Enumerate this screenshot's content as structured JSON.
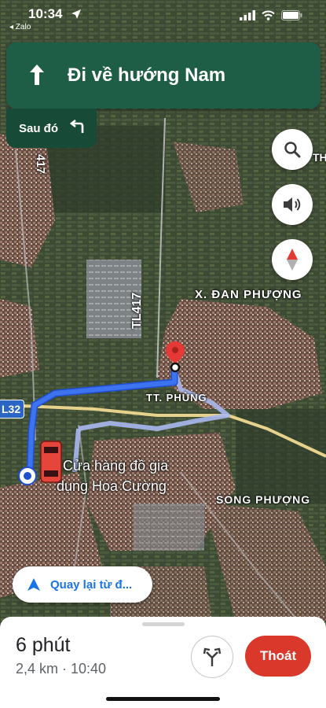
{
  "status_bar": {
    "time": "10:34",
    "back_app": "◂ Zalo"
  },
  "navigation": {
    "instruction": "Đi về hướng Nam",
    "then_label": "Sau đó"
  },
  "map": {
    "labels": {
      "district": "X. ĐAN PHƯỢNG",
      "town": "TT. PHÙNG",
      "commune": "SONG PHƯỢNG",
      "road_tl417": "TL417",
      "road_left": "417",
      "edge_th": "TH",
      "place_line1": "Cửa hàng đồ gia",
      "place_line2": "dụng Hoa Cường"
    },
    "road_badge": "L32"
  },
  "recenter": {
    "label": "Quay lại từ đ..."
  },
  "trip": {
    "eta": "6 phút",
    "distance_time": "2,4 km · 10:40",
    "exit_label": "Thoát"
  },
  "colors": {
    "banner": "#1e5d46",
    "route": "#2f62e6",
    "exit": "#d9382b",
    "accent": "#1a73e8"
  }
}
